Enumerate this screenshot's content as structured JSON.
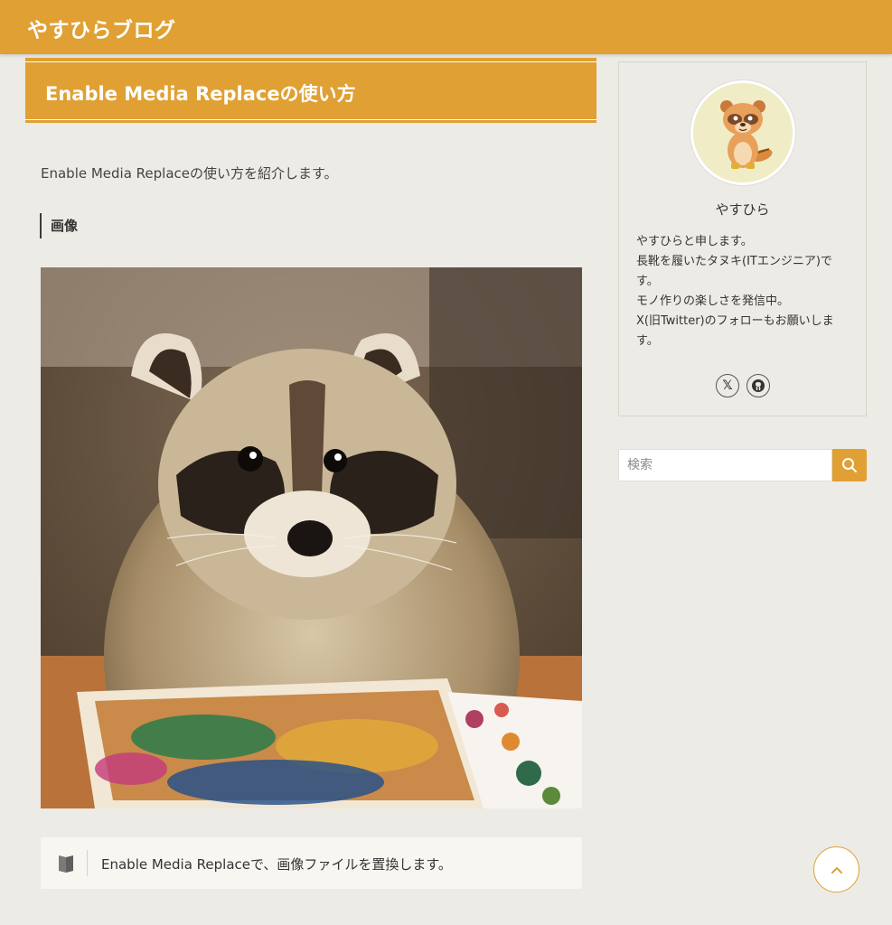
{
  "header": {
    "site_title": "やすひらブログ"
  },
  "post": {
    "title": "Enable Media Replaceの使い方",
    "intro": "Enable Media Replaceの使い方を紹介します。",
    "section_heading": "画像",
    "note": "Enable Media Replaceで、画像ファイルを置換します。"
  },
  "sidebar": {
    "profile": {
      "name": "やすひら",
      "bio": [
        "やすひらと申します。",
        "長靴を履いたタヌキ(ITエンジニア)です。",
        "モノ作りの楽しさを発信中。",
        "X(旧Twitter)のフォローもお願いします。"
      ],
      "social": {
        "x": "𝕏"
      }
    },
    "search": {
      "placeholder": "検索"
    }
  },
  "colors": {
    "accent": "#e0a033",
    "background": "#ecebe6"
  },
  "icons": [
    "book-icon",
    "x-logo-icon",
    "github-icon",
    "search-icon",
    "chevron-up-icon"
  ]
}
